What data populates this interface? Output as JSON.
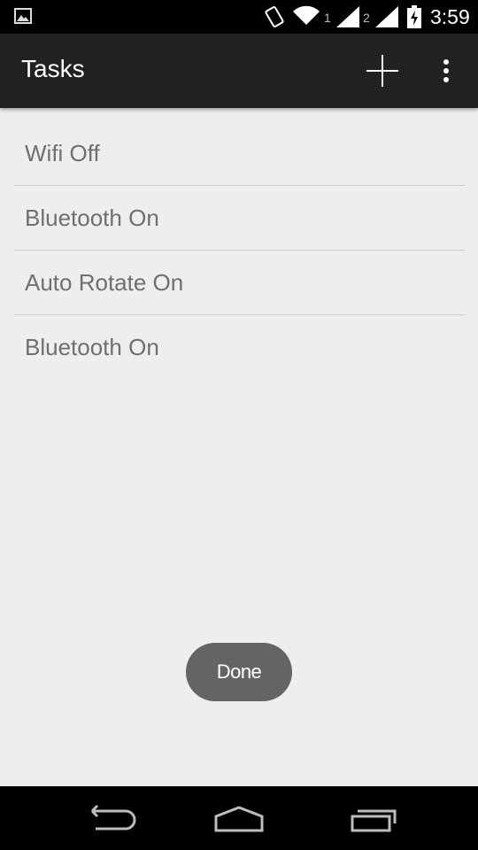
{
  "status_bar": {
    "time": "3:59",
    "sim1_label": "1",
    "sim2_label": "2",
    "icons": [
      "gallery-icon",
      "vibrate-rotate-icon",
      "wifi-icon",
      "signal-icon",
      "signal-icon",
      "battery-charging-icon"
    ]
  },
  "action_bar": {
    "title": "Tasks",
    "add_icon": "plus-icon",
    "overflow_icon": "more-vert-icon"
  },
  "tasks": [
    {
      "label": "Wifi Off"
    },
    {
      "label": "Bluetooth On"
    },
    {
      "label": "Auto Rotate On"
    },
    {
      "label": "Bluetooth On"
    }
  ],
  "done_button": {
    "label": "Done"
  },
  "nav_bar": {
    "icons": [
      "back-icon",
      "home-icon",
      "recents-icon"
    ]
  },
  "colors": {
    "action_bar_bg": "#212121",
    "content_bg": "#eeeeee",
    "task_text": "#6f6f6f",
    "done_bg": "#646464"
  }
}
